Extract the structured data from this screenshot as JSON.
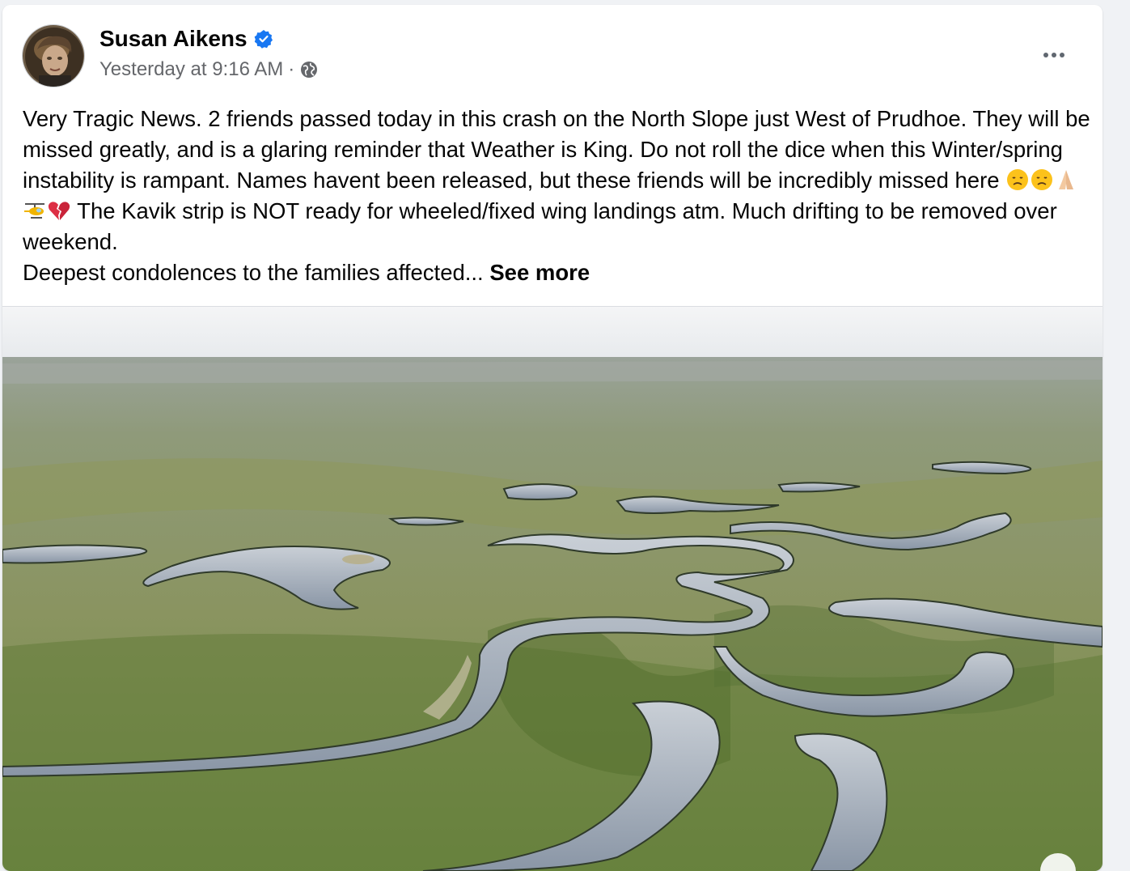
{
  "post": {
    "author": "Susan Aikens",
    "verified": true,
    "timestamp": "Yesterday at 9:16 AM",
    "separator": "·",
    "audience_icon": "globe-icon",
    "more_icon": "more-horizontal-icon",
    "text_line1": "Very Tragic News. 2 friends passed today in this crash on the North Slope just West of Prudhoe. They will be missed greatly, and is a glaring reminder that Weather is King. Do not roll the dice when this Winter/spring instability is rampant. Names havent been released, but these friends will be incredibly missed here",
    "emojis": [
      "disappointed-face",
      "disappointed-face",
      "folded-hands",
      "helicopter",
      "broken-heart"
    ],
    "text_line1_after_emoji": " The Kavik strip is NOT ready for wheeled/fixed wing landings atm. Much drifting to be removed over weekend.",
    "text_line2": " Deepest condolences to the families affected...",
    "see_more": "See more",
    "image_description_icon": "photo-aerial-river-tundra"
  },
  "colors": {
    "verified_blue": "#1877f2",
    "text": "#050505",
    "secondary_text": "#65676b",
    "background": "#f0f2f5"
  }
}
